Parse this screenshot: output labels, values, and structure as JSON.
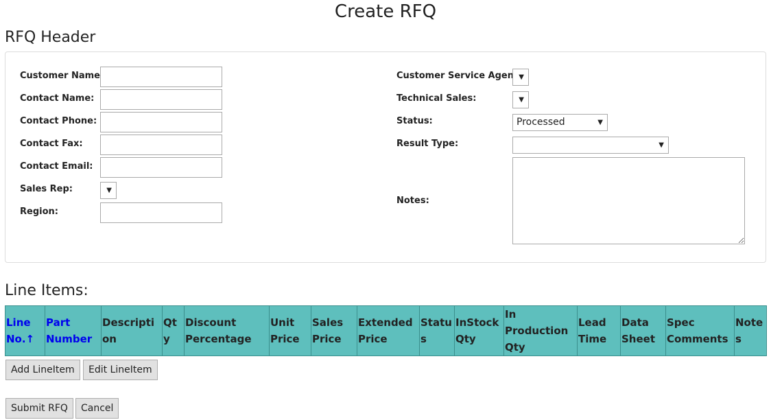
{
  "page": {
    "title": "Create RFQ"
  },
  "header_section": {
    "title": "RFQ Header",
    "left_fields": [
      {
        "label": "Customer Name:",
        "value": ""
      },
      {
        "label": "Contact Name:",
        "value": ""
      },
      {
        "label": "Contact Phone:",
        "value": ""
      },
      {
        "label": "Contact Fax:",
        "value": ""
      },
      {
        "label": "Contact Email:",
        "value": ""
      },
      {
        "label": "Sales Rep:",
        "value": ""
      },
      {
        "label": "Region:",
        "value": ""
      }
    ],
    "right_fields": [
      {
        "label": "Customer Service Agent:",
        "value": ""
      },
      {
        "label": "Technical Sales:",
        "value": ""
      },
      {
        "label": "Status:",
        "value": "Processed"
      },
      {
        "label": "Result Type:",
        "value": ""
      },
      {
        "label": "Notes:",
        "value": ""
      }
    ],
    "dropdown_arrow": "▼"
  },
  "line_items": {
    "title": "Line Items:",
    "columns": [
      "Line No.↑",
      "Part Number",
      "Description",
      "Qty",
      "Discount Percentage",
      "Unit Price",
      "Sales Price",
      "Extended Price",
      "Status",
      "InStock Qty",
      "In Production Qty",
      "Lead Time",
      "Data Sheet",
      "Spec Comments",
      "Notes"
    ],
    "header_color": "#5ebfbd",
    "link_color": "#0000ee"
  },
  "buttons": {
    "add_lineitem": "Add LineItem",
    "edit_lineitem": "Edit LineItem",
    "submit_rfq": "Submit RFQ",
    "cancel": "Cancel"
  }
}
